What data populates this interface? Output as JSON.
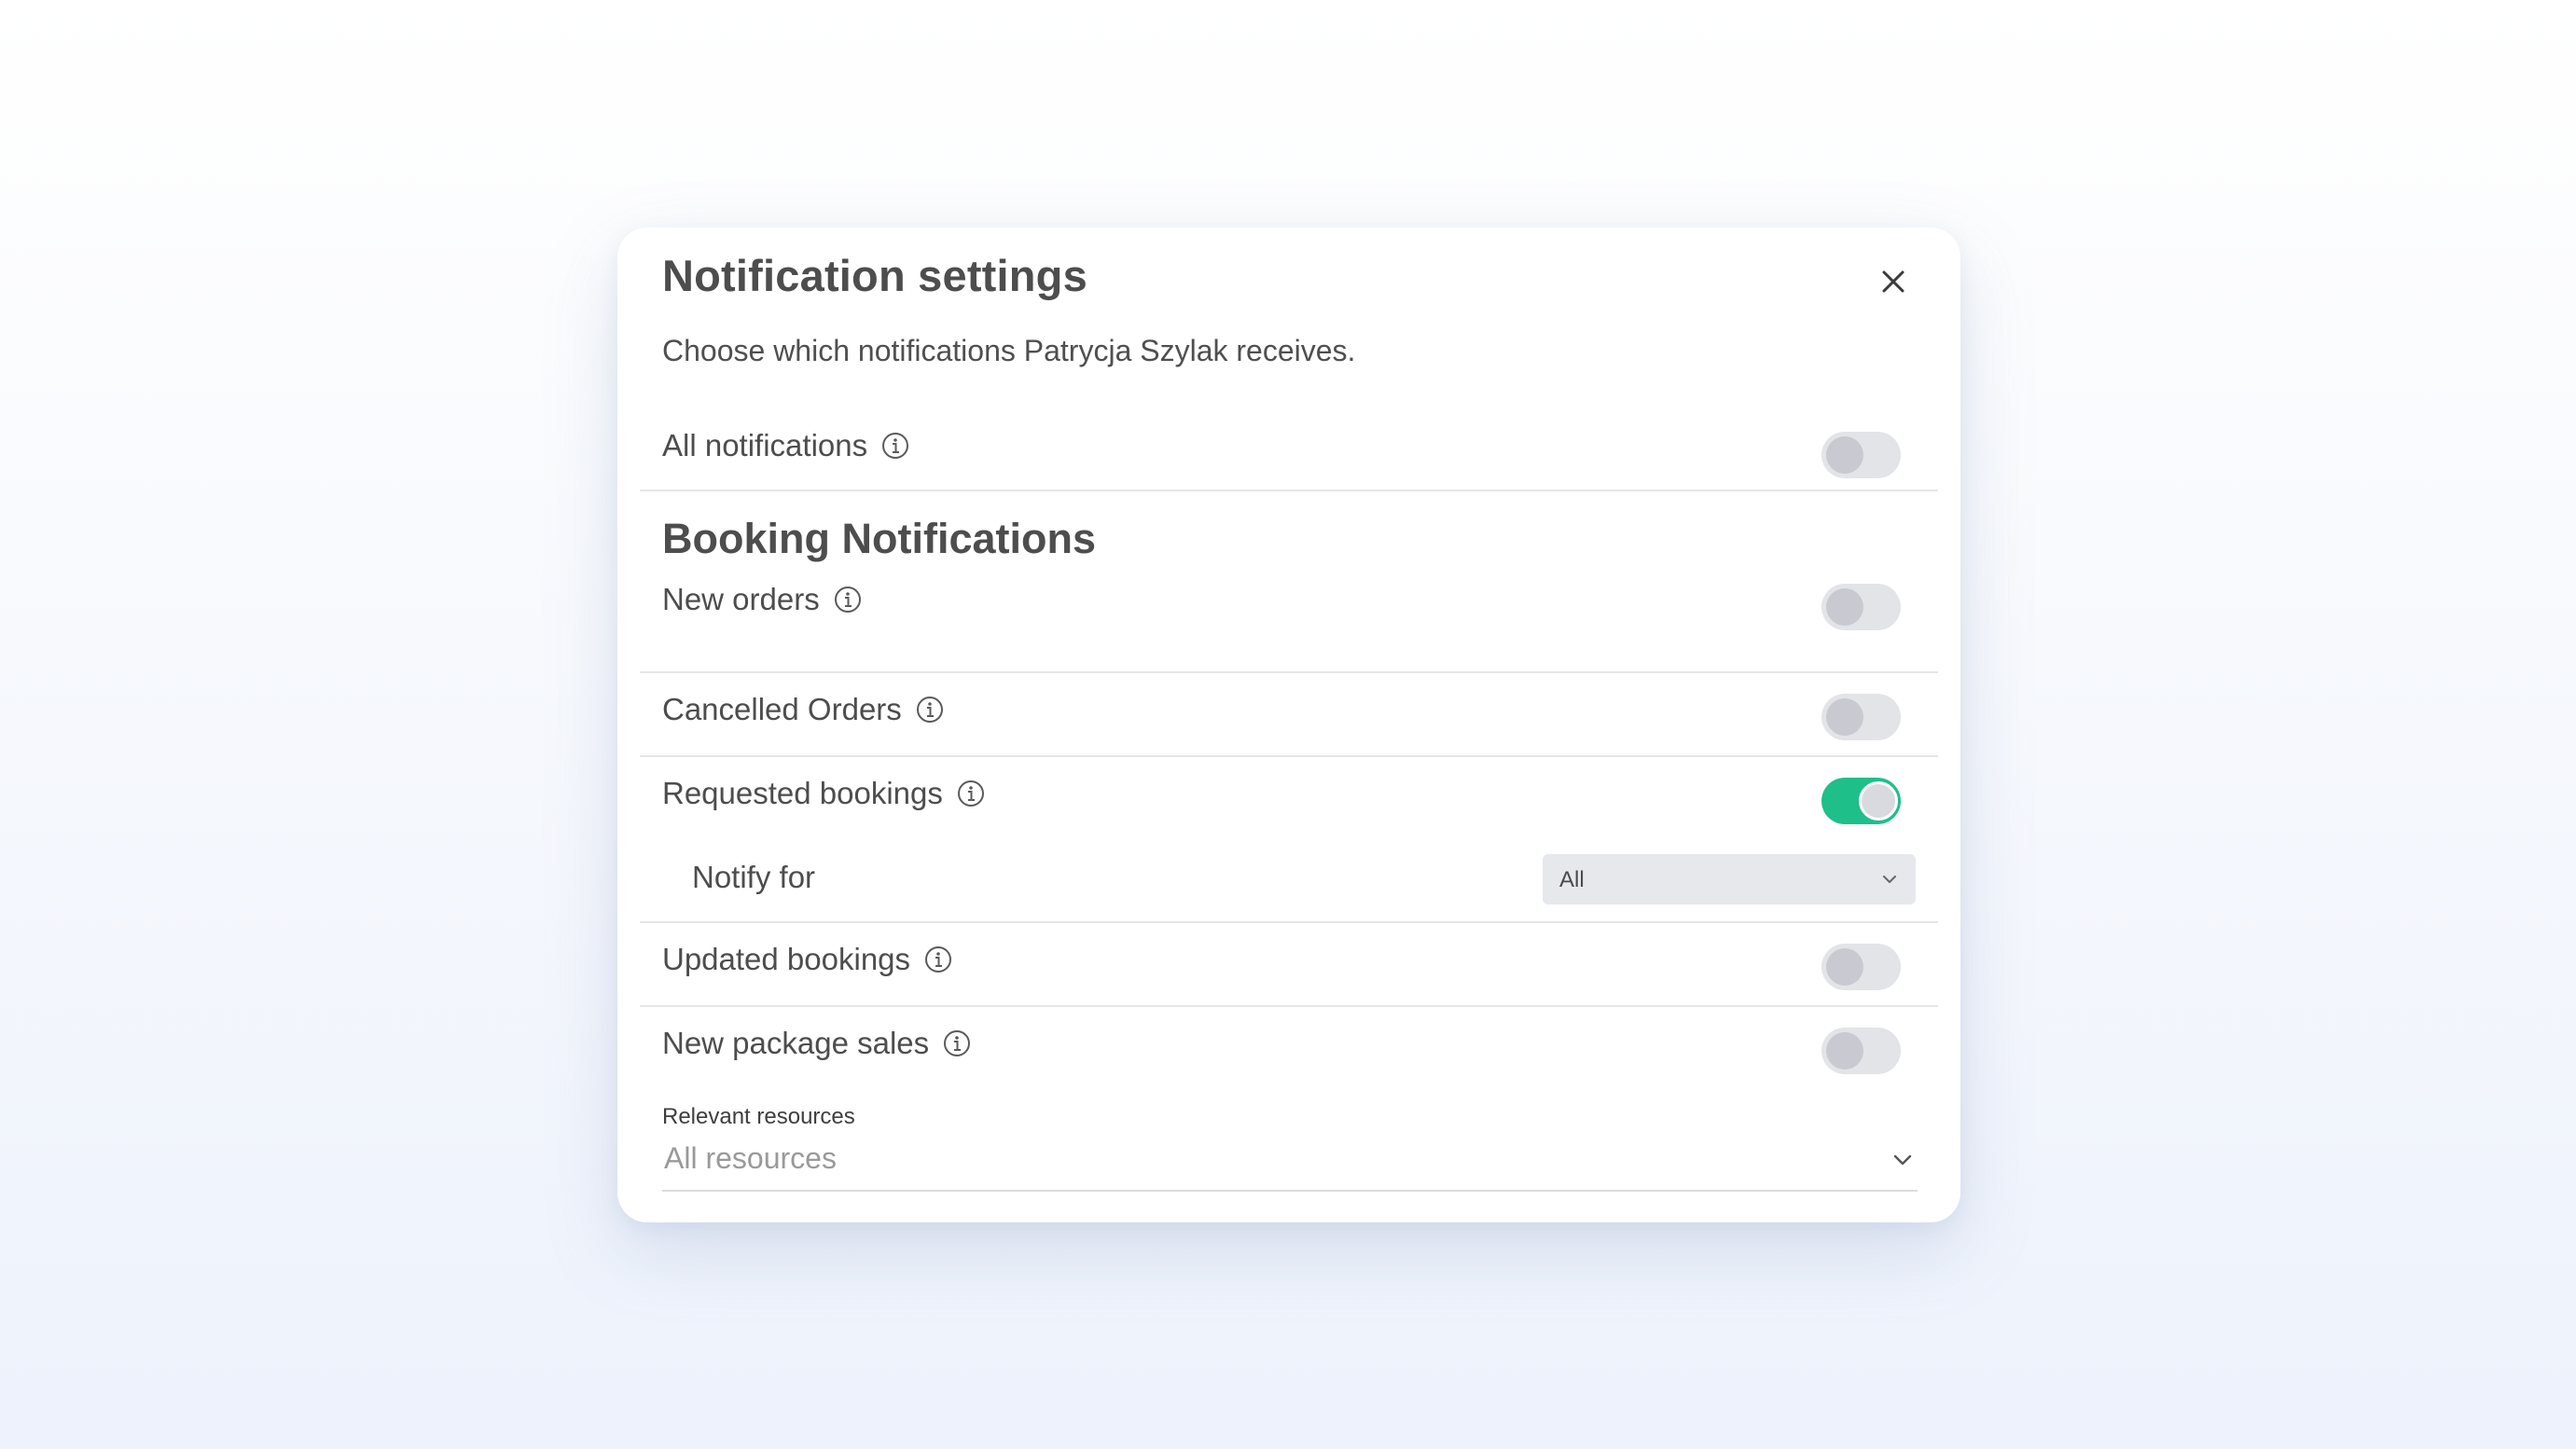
{
  "modal": {
    "title": "Notification settings",
    "subtitle": "Choose which notifications Patrycja Szylak receives.",
    "close_icon": "close-icon"
  },
  "all_notifications": {
    "label": "All notifications",
    "enabled": false
  },
  "booking_section": {
    "title": "Booking Notifications",
    "items": [
      {
        "label": "New orders",
        "enabled": false
      },
      {
        "label": "Cancelled Orders",
        "enabled": false
      },
      {
        "label": "Requested bookings",
        "enabled": true
      },
      {
        "label": "Updated bookings",
        "enabled": false
      },
      {
        "label": "New package sales",
        "enabled": false
      }
    ],
    "notify_for": {
      "label": "Notify for",
      "selected": "All"
    }
  },
  "relevant_resources": {
    "label": "Relevant resources",
    "placeholder": "All resources"
  },
  "colors": {
    "toggle_on": "#1fbf8a",
    "toggle_off": "#e3e4e8",
    "annotation_arrow": "#2f6ef0"
  }
}
